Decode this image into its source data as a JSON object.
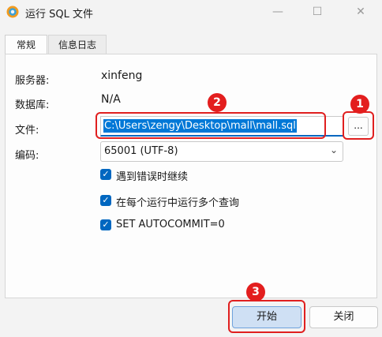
{
  "window": {
    "title": "运行 SQL 文件"
  },
  "tabs": [
    {
      "label": "常规"
    },
    {
      "label": "信息日志"
    }
  ],
  "fields": {
    "server_label": "服务器:",
    "server_value": "xinfeng",
    "database_label": "数据库:",
    "database_value": "N/A",
    "file_label": "文件:",
    "file_value": "C:\\Users\\zengy\\Desktop\\mall\\mall.sql",
    "browse_label": "...",
    "encoding_label": "编码:",
    "encoding_value": "65001 (UTF-8)"
  },
  "options": [
    {
      "label": "遇到错误时继续",
      "checked": true
    },
    {
      "label": "在每个运行中运行多个查询",
      "checked": true
    },
    {
      "label": "SET AUTOCOMMIT=0",
      "checked": true
    }
  ],
  "buttons": {
    "start": "开始",
    "close": "关闭"
  },
  "annotations": {
    "badge1": "1",
    "badge2": "2",
    "badge3": "3",
    "color": "#e31e1e"
  },
  "icons": {
    "check": "✓",
    "dropdown": "⌄",
    "minimize": "—",
    "maximize": "☐",
    "close": "✕"
  }
}
